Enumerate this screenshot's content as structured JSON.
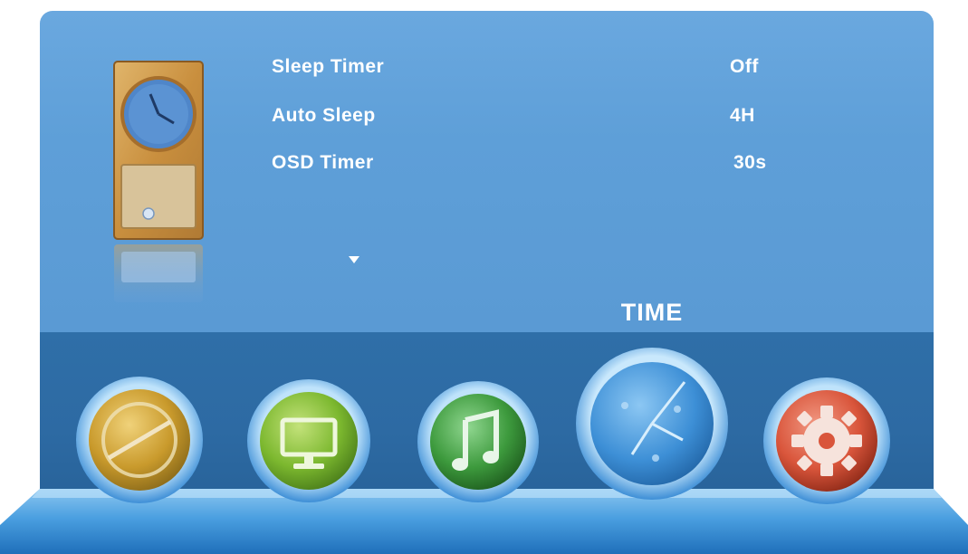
{
  "menu": {
    "items": [
      {
        "label": "Sleep Timer",
        "value": "Off"
      },
      {
        "label": "Auto Sleep",
        "value": "4H"
      },
      {
        "label": "OSD Timer",
        "value": "30s"
      }
    ],
    "selected_index": 2,
    "scroll_indicator": "down-arrow-icon"
  },
  "section_title": "TIME",
  "tabs": [
    {
      "name": "picture",
      "icon": "picture-dial-icon",
      "color": "#c9a227"
    },
    {
      "name": "screen",
      "icon": "monitor-icon",
      "color": "#7cb82f"
    },
    {
      "name": "audio",
      "icon": "music-note-icon",
      "color": "#3d9a3d"
    },
    {
      "name": "time",
      "icon": "clock-icon",
      "color": "#3d8fd6",
      "active": true
    },
    {
      "name": "setup",
      "icon": "gear-icon",
      "color": "#d9553b"
    }
  ],
  "colors": {
    "panel": "#5e9fd8",
    "tab_bar": "#2d6aa3",
    "text": "#ffffff"
  }
}
